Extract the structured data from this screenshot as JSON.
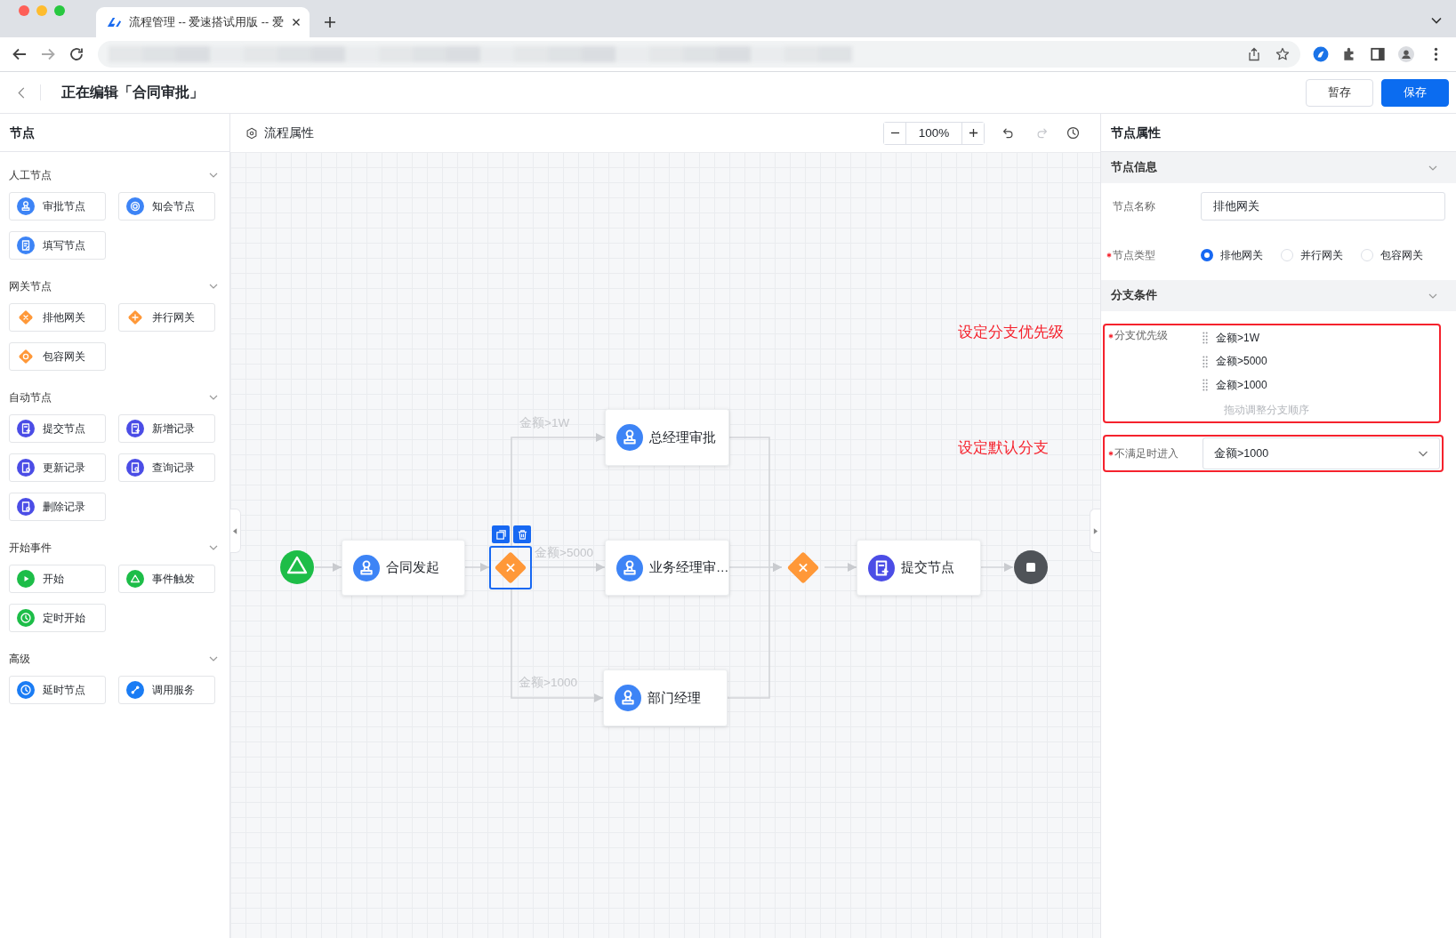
{
  "browser": {
    "tab_title": "流程管理 -- 爱速搭试用版 -- 爱"
  },
  "header": {
    "title": "正在编辑「合同审批」",
    "buttons": [
      {
        "label": "暂存",
        "kind": "default"
      },
      {
        "label": "保存",
        "kind": "primary"
      }
    ]
  },
  "sidebar": {
    "title": "节点",
    "groups": [
      {
        "title": "人工节点",
        "expanded": true,
        "items": [
          {
            "label": "审批节点",
            "kind": "approve"
          },
          {
            "label": "知会节点",
            "kind": "notify"
          },
          {
            "label": "填写节点",
            "kind": "fill"
          }
        ]
      },
      {
        "title": "网关节点",
        "expanded": true,
        "items": [
          {
            "label": "排他网关",
            "kind": "exclusive"
          },
          {
            "label": "并行网关",
            "kind": "parallel"
          },
          {
            "label": "包容网关",
            "kind": "inclusive"
          }
        ]
      },
      {
        "title": "自动节点",
        "expanded": true,
        "items": [
          {
            "label": "提交节点",
            "kind": "submit"
          },
          {
            "label": "新增记录",
            "kind": "add"
          },
          {
            "label": "更新记录",
            "kind": "update"
          },
          {
            "label": "查询记录",
            "kind": "query"
          },
          {
            "label": "删除记录",
            "kind": "delete"
          }
        ]
      },
      {
        "title": "开始事件",
        "expanded": true,
        "items": [
          {
            "label": "开始",
            "kind": "start"
          },
          {
            "label": "事件触发",
            "kind": "event"
          },
          {
            "label": "定时开始",
            "kind": "timer"
          }
        ]
      },
      {
        "title": "高级",
        "expanded": true,
        "items": [
          {
            "label": "延时节点",
            "kind": "delay"
          },
          {
            "label": "调用服务",
            "kind": "service"
          }
        ]
      }
    ]
  },
  "canvas": {
    "title": "流程属性",
    "zoom": "100%",
    "actions": [
      {
        "kind": "undo",
        "disabled": false
      },
      {
        "kind": "redo",
        "disabled": true
      },
      {
        "kind": "history",
        "disabled": false
      }
    ],
    "nodes": [
      {
        "kind": "start",
        "selected": false
      },
      {
        "kind": "task",
        "label": "合同发起",
        "selected": false
      },
      {
        "kind": "gateway",
        "selected": true
      },
      {
        "kind": "task",
        "label": "总经理审批",
        "selected": false
      },
      {
        "kind": "task",
        "label": "业务经理审…",
        "selected": false
      },
      {
        "kind": "task",
        "label": "部门经理",
        "selected": false
      },
      {
        "kind": "gateway",
        "selected": false
      },
      {
        "kind": "submit",
        "label": "提交节点",
        "selected": false
      },
      {
        "kind": "end",
        "selected": false
      }
    ],
    "branch_labels": [
      "金额>1W",
      "金额>5000",
      "金额>1000"
    ],
    "annotations": [
      "设定分支优先级",
      "设定默认分支"
    ]
  },
  "panel": {
    "title": "节点属性",
    "info": {
      "title": "节点信息",
      "expanded": true,
      "name_field": {
        "label": "节点名称",
        "value": "排他网关"
      },
      "type_field": {
        "label": "节点类型",
        "required": true,
        "options": [
          {
            "label": "排他网关",
            "selected": true
          },
          {
            "label": "并行网关",
            "selected": false
          },
          {
            "label": "包容网关",
            "selected": false
          }
        ]
      }
    },
    "branch": {
      "title": "分支条件",
      "expanded": true,
      "priority": {
        "label": "分支优先级",
        "required": true,
        "highlighted": true,
        "items": [
          "金额>1W",
          "金额>5000",
          "金额>1000"
        ],
        "hint": "拖动调整分支顺序"
      },
      "default_branch": {
        "label": "不满足时进入",
        "required": true,
        "highlighted": true,
        "value": "金额>1000"
      }
    }
  }
}
